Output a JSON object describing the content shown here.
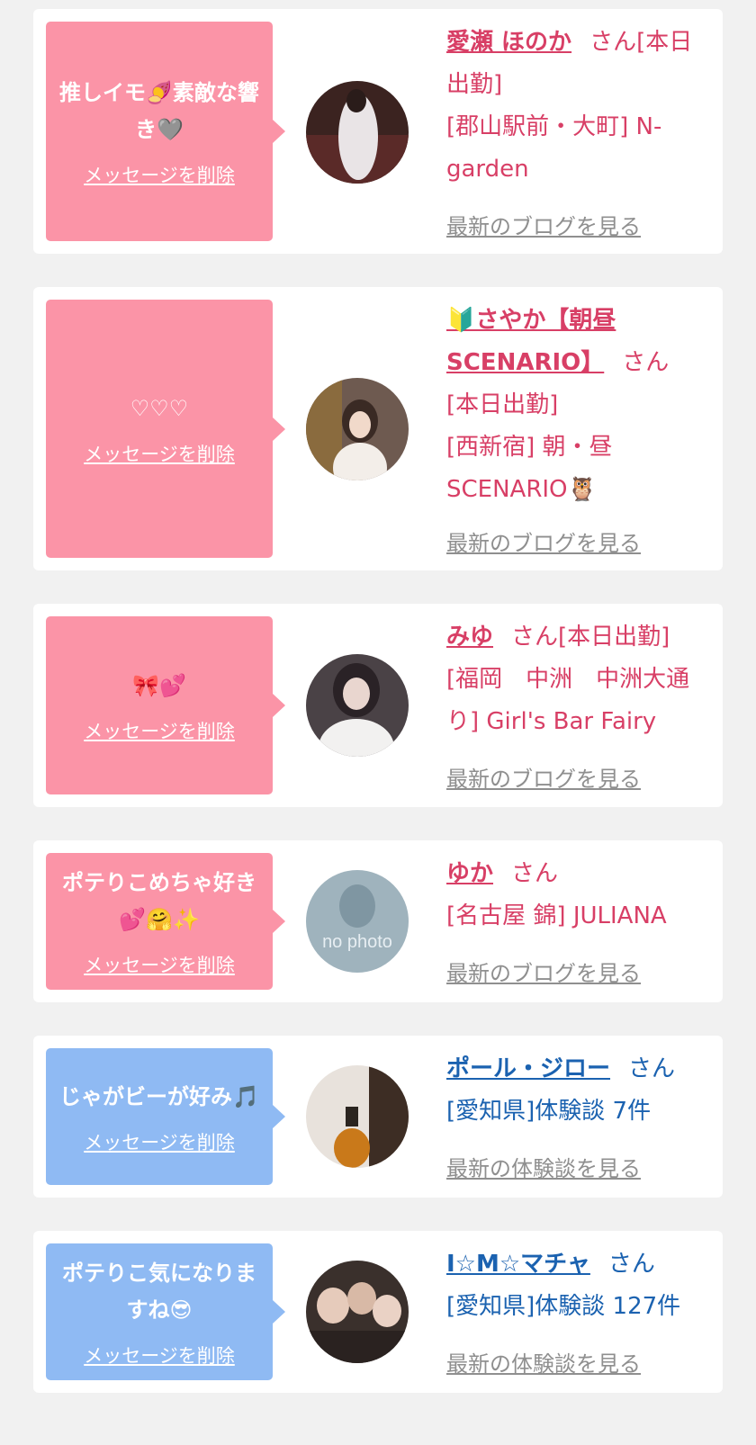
{
  "items": [
    {
      "theme": "pink",
      "message": "推しイモ🍠素敵な響き🩶",
      "delete_label": "メッセージを削除",
      "avatar_icon": "profile-photo",
      "name": "愛瀬 ほのか",
      "honorific": "さん",
      "status": "[本日出勤]",
      "area_shop": "[郡山駅前・大町] N-garden",
      "link_label": "最新のブログを見る"
    },
    {
      "theme": "pink",
      "message": "♡♡♡",
      "delete_label": "メッセージを削除",
      "avatar_icon": "profile-photo",
      "name": "🔰さやか【朝昼SCENARIO】",
      "honorific": "さん",
      "status": "[本日出勤]",
      "area_shop": "[西新宿] 朝・昼SCENARIO🦉",
      "link_label": "最新のブログを見る"
    },
    {
      "theme": "pink",
      "message": "🎀💕",
      "delete_label": "メッセージを削除",
      "avatar_icon": "profile-photo",
      "name": "みゆ",
      "honorific": "さん",
      "status": "[本日出勤]",
      "area_shop": "[福岡　中洲　中洲大通り] Girl's Bar Fairy",
      "link_label": "最新のブログを見る"
    },
    {
      "theme": "pink",
      "message": "ポテりこめちゃ好き💕🤗✨",
      "delete_label": "メッセージを削除",
      "avatar_icon": "no-photo",
      "avatar_text": "no photo",
      "name": "ゆか",
      "honorific": "さん",
      "status": "",
      "area_shop": "[名古屋 錦] JULIANA",
      "link_label": "最新のブログを見る"
    },
    {
      "theme": "blue",
      "message": "じゃがビーが好み🎵",
      "delete_label": "メッセージを削除",
      "avatar_icon": "profile-photo",
      "name": "ポール・ジロー",
      "honorific": "さん",
      "status": "",
      "area_shop": "[愛知県]体験談 7件",
      "link_label": "最新の体験談を見る"
    },
    {
      "theme": "blue",
      "message": "ポテりこ気になりますね😎",
      "delete_label": "メッセージを削除",
      "avatar_icon": "profile-photo",
      "name": "I☆M☆マチャ",
      "honorific": "さん",
      "status": "",
      "area_shop": "[愛知県]体験談 127件",
      "link_label": "最新の体験談を見る"
    }
  ]
}
